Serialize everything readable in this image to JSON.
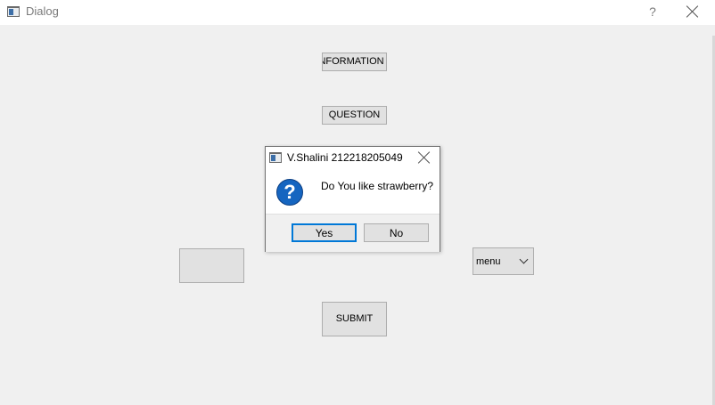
{
  "window": {
    "title": "Dialog",
    "help_label": "?",
    "icon": "window-app-icon",
    "close_icon": "close-icon"
  },
  "buttons": {
    "information_label": "INFORMATION",
    "question_label": "QUESTION",
    "blank_label": "",
    "submit_label": "SUBMIT"
  },
  "combo": {
    "selected": "menu",
    "icon": "chevron-down-icon"
  },
  "message_box": {
    "title": "V.Shalini 212218205049",
    "text": "Do You like strawberry?",
    "icon": "question-icon",
    "icon_glyph": "?",
    "yes_label": "Yes",
    "no_label": "No"
  },
  "colors": {
    "focus_border": "#0078d7",
    "question_icon": "#1565c0"
  }
}
